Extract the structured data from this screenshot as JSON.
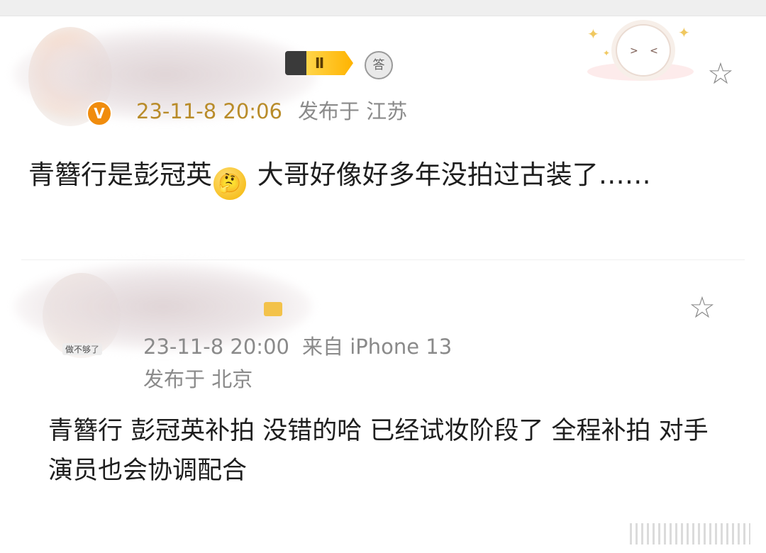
{
  "post1": {
    "level_badge": "Ⅱ",
    "medal_badge": "答",
    "vip_badge": "V",
    "timestamp": "23-11-8 20:06",
    "location": "发布于 江苏",
    "content_before_emoji": "青簪行是彭冠英",
    "emoji": "🤔",
    "content_after_emoji": " 大哥好像好多年没拍过古装了……",
    "star_icon": "☆"
  },
  "post2": {
    "avatar_caption": "做不够了",
    "timestamp": "23-11-8 20:00",
    "source": "来自 iPhone 13",
    "location": "发布于 北京",
    "content": "青簪行 彭冠英补拍 没错的哈 已经试妆阶段了 全程补拍 对手演员也会协调配合",
    "star_icon": "☆"
  },
  "colors": {
    "timestamp_gold": "#b98c2a",
    "meta_gray": "#8a8a8a",
    "vip_orange": "#f08c0d"
  },
  "icons": [
    "vip-badge-icon",
    "level-badge-icon",
    "medal-icon",
    "sheep-sticker-icon",
    "star-icon",
    "thinking-emoji-icon"
  ]
}
